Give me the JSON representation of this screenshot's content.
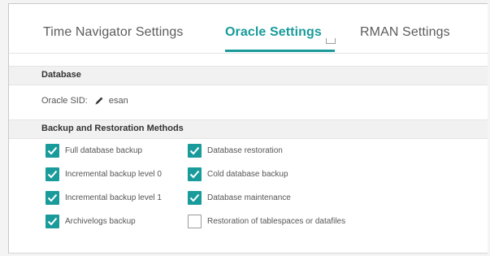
{
  "tabs": [
    {
      "label": "Time Navigator Settings",
      "active": false
    },
    {
      "label": "Oracle Settings",
      "active": true
    },
    {
      "label": "RMAN Settings",
      "active": false
    }
  ],
  "database": {
    "section_title": "Database",
    "sid_label": "Oracle SID:",
    "sid_value": "esan"
  },
  "backup": {
    "section_title": "Backup and Restoration Methods",
    "options": [
      {
        "label": "Full database backup",
        "checked": true
      },
      {
        "label": "Incremental backup level 0",
        "checked": true
      },
      {
        "label": "Incremental backup level 1",
        "checked": true
      },
      {
        "label": "Archivelogs backup",
        "checked": true
      },
      {
        "label": "Database restoration",
        "checked": true
      },
      {
        "label": "Cold database backup",
        "checked": true
      },
      {
        "label": "Database maintenance",
        "checked": true
      },
      {
        "label": "Restoration of tablespaces or datafiles",
        "checked": false
      }
    ]
  },
  "colors": {
    "accent": "#1a9b9b",
    "tab_text": "#5c5c5c",
    "section_bg": "#f1f1f1"
  }
}
